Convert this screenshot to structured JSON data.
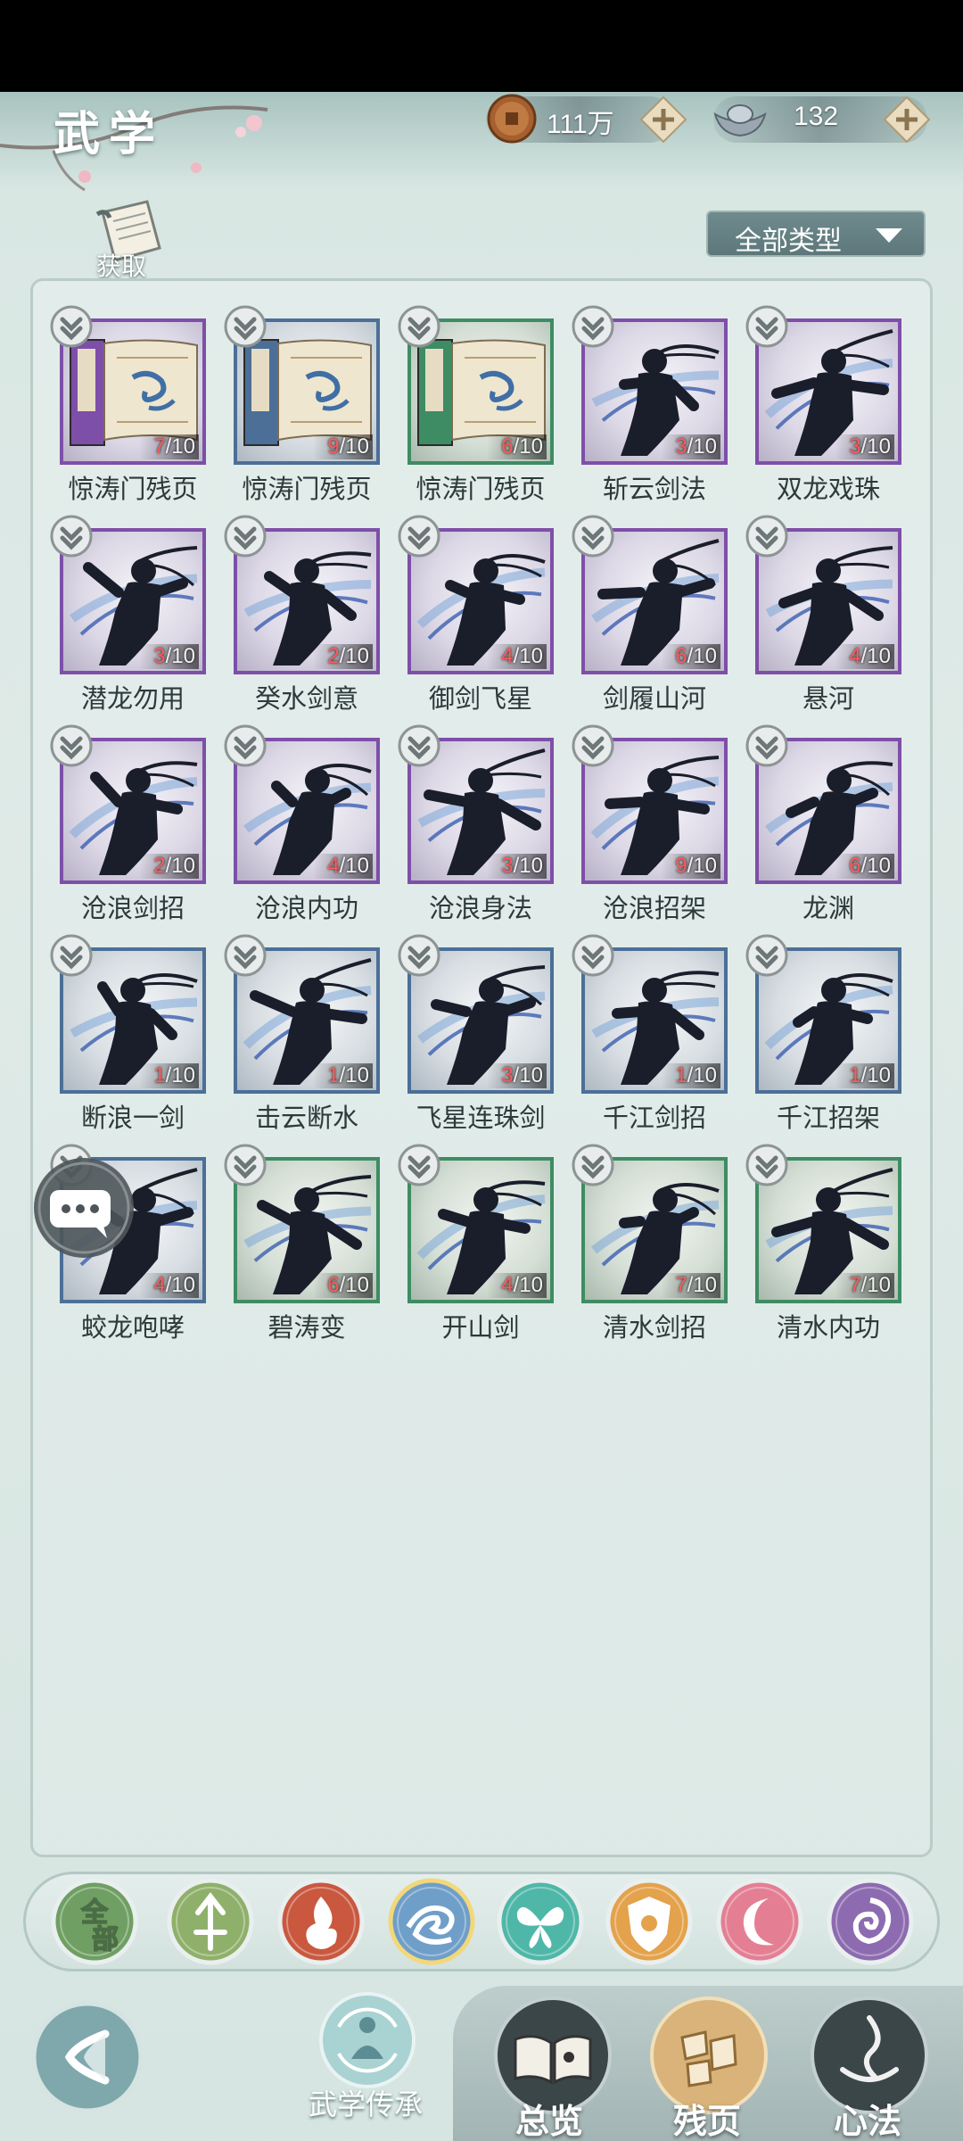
{
  "header": {
    "title": "武学",
    "copper": {
      "value": "111万",
      "icon": "copper-coin-icon"
    },
    "silver": {
      "value": "132",
      "icon": "silver-ingot-icon"
    }
  },
  "acquire": {
    "label": "获取",
    "icon": "scroll-icon"
  },
  "filter": {
    "label": "全部类型",
    "icon": "triangle-down-icon"
  },
  "skills": [
    {
      "name": "惊涛门残页",
      "have": "7",
      "total": "/10",
      "rarity": "purple",
      "kind": "book"
    },
    {
      "name": "惊涛门残页",
      "have": "9",
      "total": "/10",
      "rarity": "blue",
      "kind": "book"
    },
    {
      "name": "惊涛门残页",
      "have": "6",
      "total": "/10",
      "rarity": "green",
      "kind": "book"
    },
    {
      "name": "斩云剑法",
      "have": "3",
      "total": "/10",
      "rarity": "purple",
      "kind": "figure"
    },
    {
      "name": "双龙戏珠",
      "have": "3",
      "total": "/10",
      "rarity": "purple",
      "kind": "figure"
    },
    {
      "name": "潜龙勿用",
      "have": "3",
      "total": "/10",
      "rarity": "purple",
      "kind": "figure"
    },
    {
      "name": "癸水剑意",
      "have": "2",
      "total": "/10",
      "rarity": "purple",
      "kind": "figure"
    },
    {
      "name": "御剑飞星",
      "have": "4",
      "total": "/10",
      "rarity": "purple",
      "kind": "figure"
    },
    {
      "name": "剑履山河",
      "have": "6",
      "total": "/10",
      "rarity": "purple",
      "kind": "figure"
    },
    {
      "name": "悬河",
      "have": "4",
      "total": "/10",
      "rarity": "purple",
      "kind": "figure"
    },
    {
      "name": "沧浪剑招",
      "have": "2",
      "total": "/10",
      "rarity": "purple",
      "kind": "figure"
    },
    {
      "name": "沧浪内功",
      "have": "4",
      "total": "/10",
      "rarity": "purple",
      "kind": "figure"
    },
    {
      "name": "沧浪身法",
      "have": "3",
      "total": "/10",
      "rarity": "purple",
      "kind": "figure"
    },
    {
      "name": "沧浪招架",
      "have": "9",
      "total": "/10",
      "rarity": "purple",
      "kind": "figure"
    },
    {
      "name": "龙渊",
      "have": "6",
      "total": "/10",
      "rarity": "purple",
      "kind": "figure"
    },
    {
      "name": "断浪一剑",
      "have": "1",
      "total": "/10",
      "rarity": "blue",
      "kind": "figure"
    },
    {
      "name": "击云断水",
      "have": "1",
      "total": "/10",
      "rarity": "blue",
      "kind": "figure"
    },
    {
      "name": "飞星连珠剑",
      "have": "3",
      "total": "/10",
      "rarity": "blue",
      "kind": "figure"
    },
    {
      "name": "千江剑招",
      "have": "1",
      "total": "/10",
      "rarity": "blue",
      "kind": "figure"
    },
    {
      "name": "千江招架",
      "have": "1",
      "total": "/10",
      "rarity": "blue",
      "kind": "figure"
    },
    {
      "name": "蛟龙咆哮",
      "have": "4",
      "total": "/10",
      "rarity": "blue",
      "kind": "figure"
    },
    {
      "name": "碧涛变",
      "have": "6",
      "total": "/10",
      "rarity": "green",
      "kind": "figure"
    },
    {
      "name": "开山剑",
      "have": "4",
      "total": "/10",
      "rarity": "green",
      "kind": "figure"
    },
    {
      "name": "清水剑招",
      "have": "7",
      "total": "/10",
      "rarity": "green",
      "kind": "figure"
    },
    {
      "name": "清水内功",
      "have": "7",
      "total": "/10",
      "rarity": "green",
      "kind": "figure"
    }
  ],
  "categories": [
    {
      "label": "全部",
      "icon": "all-category-icon",
      "color": "#6f9f63",
      "selected": false
    },
    {
      "label": "",
      "icon": "arrow-category-icon",
      "color": "#8fb06a"
    },
    {
      "label": "",
      "icon": "flame-category-icon",
      "color": "#c9583f"
    },
    {
      "label": "",
      "icon": "wave-category-icon",
      "color": "#6f9fc9",
      "selected": true
    },
    {
      "label": "",
      "icon": "butterfly-category-icon",
      "color": "#4fb7a8"
    },
    {
      "label": "",
      "icon": "shield-category-icon",
      "color": "#e3a24b"
    },
    {
      "label": "",
      "icon": "moon-category-icon",
      "color": "#e47f93"
    },
    {
      "label": "",
      "icon": "rose-category-icon",
      "color": "#8d6bb0"
    }
  ],
  "bottom_nav": {
    "inherit": "武学传承",
    "overview": "总览",
    "fragments": "残页",
    "mind": "心法"
  },
  "colors": {
    "purple": "#7e4fa8",
    "blue": "#4b6f97",
    "green": "#3e8c63"
  }
}
